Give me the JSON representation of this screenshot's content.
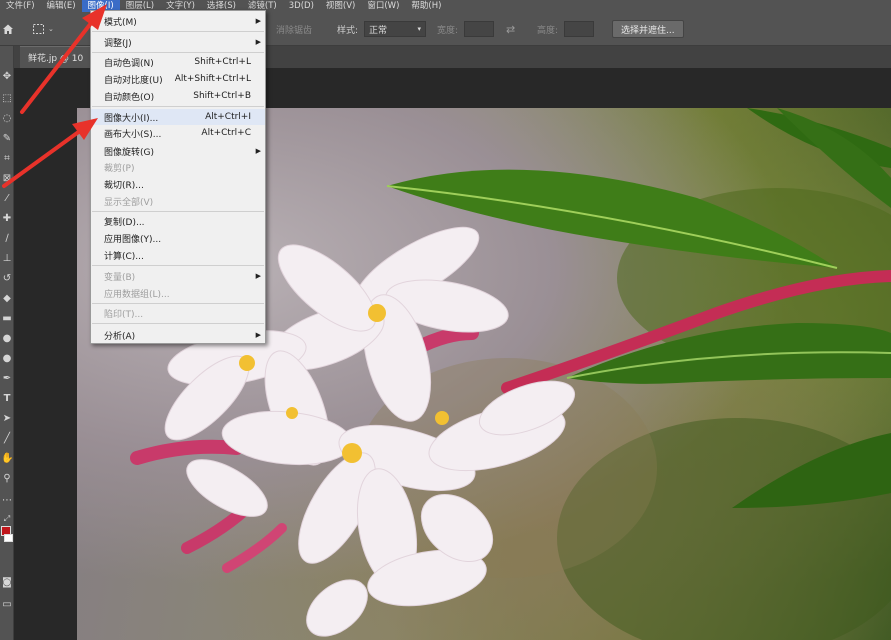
{
  "menubar": {
    "items": [
      {
        "label": "文件(F)"
      },
      {
        "label": "编辑(E)"
      },
      {
        "label": "图像(I)"
      },
      {
        "label": "图层(L)"
      },
      {
        "label": "文字(Y)"
      },
      {
        "label": "选择(S)"
      },
      {
        "label": "滤镜(T)"
      },
      {
        "label": "3D(D)"
      },
      {
        "label": "视图(V)"
      },
      {
        "label": "窗口(W)"
      },
      {
        "label": "帮助(H)"
      }
    ]
  },
  "options": {
    "antialias_label": "消除锯齿",
    "style_label": "样式:",
    "style_value": "正常",
    "width_label": "宽度:",
    "height_label": "高度:",
    "select_mask_button": "选择并遮住..."
  },
  "document": {
    "tab_label": "鲜花.jp @ 10"
  },
  "image_menu": {
    "items": [
      {
        "label": "模式(M)",
        "shortcut": "",
        "submenu": true,
        "disabled": false
      },
      {
        "label": "调整(J)",
        "shortcut": "",
        "submenu": true,
        "disabled": false
      },
      {
        "label": "自动色调(N)",
        "shortcut": "Shift+Ctrl+L",
        "submenu": false,
        "disabled": false
      },
      {
        "label": "自动对比度(U)",
        "shortcut": "Alt+Shift+Ctrl+L",
        "submenu": false,
        "disabled": false
      },
      {
        "label": "自动颜色(O)",
        "shortcut": "Shift+Ctrl+B",
        "submenu": false,
        "disabled": false
      },
      {
        "label": "图像大小(I)...",
        "shortcut": "Alt+Ctrl+I",
        "submenu": false,
        "disabled": false
      },
      {
        "label": "画布大小(S)...",
        "shortcut": "Alt+Ctrl+C",
        "submenu": false,
        "disabled": false
      },
      {
        "label": "图像旋转(G)",
        "shortcut": "",
        "submenu": true,
        "disabled": false
      },
      {
        "label": "裁剪(P)",
        "shortcut": "",
        "submenu": false,
        "disabled": true
      },
      {
        "label": "裁切(R)...",
        "shortcut": "",
        "submenu": false,
        "disabled": false
      },
      {
        "label": "显示全部(V)",
        "shortcut": "",
        "submenu": false,
        "disabled": true
      },
      {
        "label": "复制(D)...",
        "shortcut": "",
        "submenu": false,
        "disabled": false
      },
      {
        "label": "应用图像(Y)...",
        "shortcut": "",
        "submenu": false,
        "disabled": false
      },
      {
        "label": "计算(C)...",
        "shortcut": "",
        "submenu": false,
        "disabled": false
      },
      {
        "label": "变量(B)",
        "shortcut": "",
        "submenu": true,
        "disabled": true
      },
      {
        "label": "应用数据组(L)...",
        "shortcut": "",
        "submenu": false,
        "disabled": true
      },
      {
        "label": "陷印(T)...",
        "shortcut": "",
        "submenu": false,
        "disabled": true
      },
      {
        "label": "分析(A)",
        "shortcut": "",
        "submenu": true,
        "disabled": false
      }
    ]
  },
  "colors": {
    "menu_highlight": "#3a6cc7",
    "annotation_red": "#e8322a",
    "foreground_swatch": "#c0161b",
    "background_swatch": "#ffffff"
  }
}
